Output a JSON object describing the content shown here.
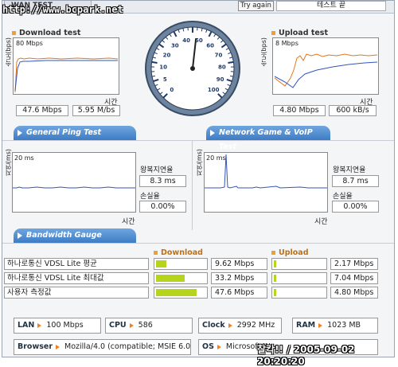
{
  "header": {
    "tab": "WAN TEST",
    "watermark": "http://www.bcpark.net",
    "try_again": "Try again",
    "status": "테스트 끝"
  },
  "download": {
    "title": "Download test",
    "scale": "80 Mbps",
    "axis": "속도(bps)",
    "time": "시간",
    "mbps": "47.6 Mbps",
    "mbs": "5.95 M/bs"
  },
  "upload": {
    "title": "Upload test",
    "scale": "8 Mbps",
    "axis": "속도(bps)",
    "time": "시간",
    "mbps": "4.80 Mbps",
    "kbs": "600 kB/s"
  },
  "gauge": {
    "ticks": [
      "0",
      "5",
      "10",
      "20",
      "30",
      "40",
      "50",
      "60",
      "70",
      "80",
      "90",
      "100"
    ],
    "value": 47.6
  },
  "ping": {
    "title": "General Ping Test",
    "scale": "20 ms",
    "axis": "지연(ms)",
    "time": "시간",
    "latency_label": "왕복지연율",
    "latency": "8.3 ms",
    "loss_label": "손실율",
    "loss": "0.00%"
  },
  "game": {
    "title": "Network Game & VoIP Test",
    "scale": "20 ms",
    "axis": "지연(ms)",
    "time": "시간",
    "latency_label": "왕복지연율",
    "latency": "8.7 ms",
    "loss_label": "손실율",
    "loss": "0.00%"
  },
  "bandwidth": {
    "title": "Bandwidth Gauge",
    "download_label": "Download",
    "upload_label": "Upload",
    "rows": [
      {
        "label": "하나로통신 VDSL Lite 평균",
        "down": "9.62 Mbps",
        "down_pct": 0.2,
        "up": "2.17 Mbps",
        "up_pct": 0.05
      },
      {
        "label": "하나로통신 VDSL Lite 최대값",
        "down": "33.2 Mbps",
        "down_pct": 0.56,
        "up": "7.04 Mbps",
        "up_pct": 0.05
      },
      {
        "label": "사용자 측정값",
        "down": "47.6 Mbps",
        "down_pct": 0.79,
        "up": "4.80 Mbps",
        "up_pct": 0.05
      }
    ]
  },
  "system": {
    "lan_k": "LAN",
    "lan_v": "100 Mbps",
    "cpu_k": "CPU",
    "cpu_v": "586",
    "clock_k": "Clock",
    "clock_v": "2992 MHz",
    "ram_k": "RAM",
    "ram_v": "1023 MB",
    "browser_k": "Browser",
    "browser_v": "Mozilla/4.0 (compatible; MSIE 6.0",
    "os_k": "OS",
    "os_v": "Microsoft W"
  },
  "stamp": "찰칵!! / 2005-09-02 20:20:20",
  "colors": {
    "accent": "#f0a030",
    "pill": "#3d7cc4",
    "bar": "#b6d41c"
  }
}
